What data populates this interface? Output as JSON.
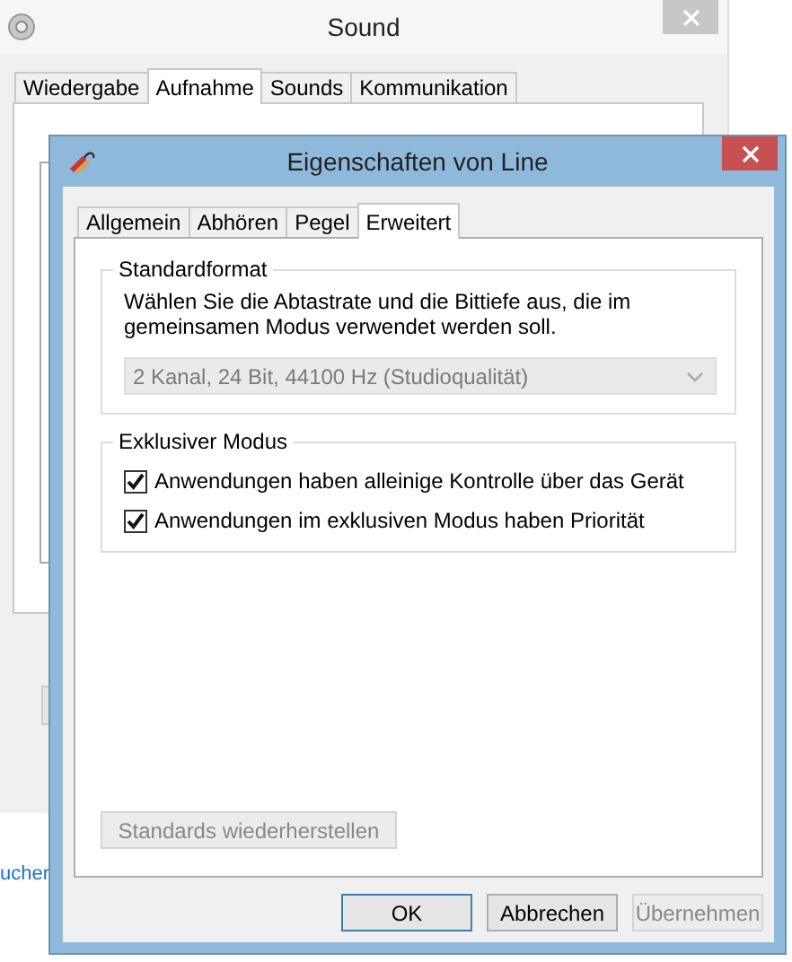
{
  "back_window": {
    "title": "Sound",
    "tabs": [
      {
        "label": "Wiedergabe",
        "selected": false
      },
      {
        "label": "Aufnahme",
        "selected": true
      },
      {
        "label": "Sounds",
        "selected": false
      },
      {
        "label": "Kommunikation",
        "selected": false
      }
    ],
    "link": "ucher"
  },
  "dialog": {
    "title": "Eigenschaften von Line",
    "tabs": [
      {
        "label": "Allgemein",
        "selected": false
      },
      {
        "label": "Abhören",
        "selected": false
      },
      {
        "label": "Pegel",
        "selected": false
      },
      {
        "label": "Erweitert",
        "selected": true
      }
    ],
    "format_group": {
      "title": "Standardformat",
      "description": "Wählen Sie die Abtastrate und die Bittiefe aus, die im gemeinsamen Modus verwendet werden soll.",
      "dropdown": {
        "value": "2 Kanal, 24 Bit, 44100 Hz (Studioqualität)",
        "disabled": true
      }
    },
    "exclusive_group": {
      "title": "Exklusiver Modus",
      "options": [
        {
          "label": "Anwendungen haben alleinige Kontrolle über das Gerät",
          "checked": true
        },
        {
          "label": "Anwendungen im exklusiven Modus haben Priorität",
          "checked": true
        }
      ]
    },
    "restore_button": {
      "label": "Standards wiederherstellen",
      "disabled": true
    },
    "buttons": [
      {
        "label": "OK",
        "disabled": false,
        "default": true
      },
      {
        "label": "Abbrechen",
        "disabled": false,
        "default": false
      },
      {
        "label": "Übernehmen",
        "disabled": true,
        "default": false
      }
    ]
  }
}
